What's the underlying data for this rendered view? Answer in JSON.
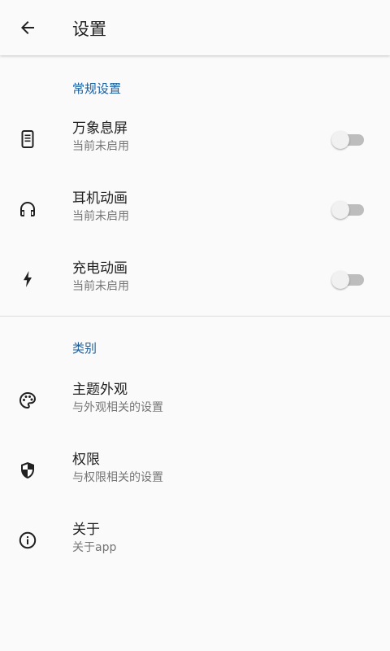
{
  "appbar": {
    "title": "设置",
    "back_icon": "arrow-back-icon"
  },
  "sections": {
    "general": {
      "header": "常规设置",
      "items": [
        {
          "title": "万象息屏",
          "subtitle": "当前未启用",
          "icon": "phone-screen-icon",
          "enabled": false
        },
        {
          "title": "耳机动画",
          "subtitle": "当前未启用",
          "icon": "headphones-icon",
          "enabled": false
        },
        {
          "title": "充电动画",
          "subtitle": "当前未启用",
          "icon": "flash-icon",
          "enabled": false
        }
      ]
    },
    "categories": {
      "header": "类别",
      "items": [
        {
          "title": "主题外观",
          "subtitle": "与外观相关的设置",
          "icon": "palette-icon"
        },
        {
          "title": "权限",
          "subtitle": "与权限相关的设置",
          "icon": "shield-icon"
        },
        {
          "title": "关于",
          "subtitle": "关于app",
          "icon": "info-icon"
        }
      ]
    }
  },
  "colors": {
    "accent": "#1a5fa0",
    "background": "#fafafa",
    "switch_off_track": "#bdbdbd",
    "switch_off_thumb": "#f1f1f1"
  }
}
